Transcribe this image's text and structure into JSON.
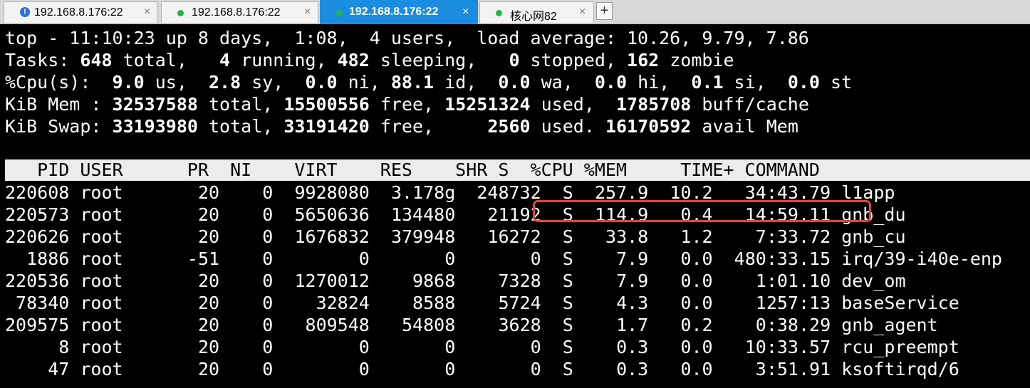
{
  "tabs": [
    {
      "label": "192.168.8.176:22",
      "status": "warning",
      "icon": "info-icon",
      "active": false
    },
    {
      "label": "192.168.8.176:22",
      "status": "connected",
      "icon": "status-dot-icon",
      "active": false
    },
    {
      "label": "192.168.8.176:22",
      "status": "connected",
      "icon": "status-dot-icon",
      "active": true
    },
    {
      "label": "核心网82",
      "status": "connected",
      "icon": "status-dot-icon",
      "active": false
    }
  ],
  "tab_close_glyph": "×",
  "new_tab_glyph": "+",
  "summary": {
    "line1": "top - 11:10:23 up 8 days,  1:08,  4 users,  load average: 10.26, 9.79, 7.86",
    "tasks": {
      "prefix": "Tasks: ",
      "total": "648",
      "total_lbl": " total,   ",
      "running": "4",
      "running_lbl": " running, ",
      "sleeping": "482",
      "sleeping_lbl": " sleeping,   ",
      "stopped": "0",
      "stopped_lbl": " stopped, ",
      "zombie": "162",
      "zombie_lbl": " zombie"
    },
    "cpu": {
      "prefix": "%Cpu(s):  ",
      "us": "9.0",
      "us_lbl": " us,  ",
      "sy": "2.8",
      "sy_lbl": " sy,  ",
      "ni": "0.0",
      "ni_lbl": " ni, ",
      "id": "88.1",
      "id_lbl": " id,  ",
      "wa": "0.0",
      "wa_lbl": " wa,  ",
      "hi": "0.0",
      "hi_lbl": " hi,  ",
      "si": "0.1",
      "si_lbl": " si,  ",
      "st": "0.0",
      "st_lbl": " st"
    },
    "mem": {
      "prefix": "KiB Mem : ",
      "total": "32537588",
      "total_lbl": " total, ",
      "free": "15500556",
      "free_lbl": " free, ",
      "used": "15251324",
      "used_lbl": " used,  ",
      "buff": "1785708",
      "buff_lbl": " buff/cache"
    },
    "swap": {
      "prefix": "KiB Swap: ",
      "total": "33193980",
      "total_lbl": " total, ",
      "free": "33191420",
      "free_lbl": " free,     ",
      "used": "2560",
      "used_lbl": " used. ",
      "avail": "16170592",
      "avail_lbl": " avail Mem"
    }
  },
  "table": {
    "header": "   PID USER      PR  NI    VIRT    RES    SHR S  %CPU %MEM     TIME+ COMMAND",
    "rows": [
      {
        "pid": "220608",
        "user": "root",
        "pr": "20",
        "ni": "0",
        "virt": "9928080",
        "res": "3.178g",
        "shr": "248732",
        "s": "S",
        "cpu": "257.9",
        "mem": "10.2",
        "time": "34:43.79",
        "cmd": "l1app"
      },
      {
        "pid": "220573",
        "user": "root",
        "pr": "20",
        "ni": "0",
        "virt": "5650636",
        "res": "134480",
        "shr": "21192",
        "s": "S",
        "cpu": "114.9",
        "mem": "0.4",
        "time": "14:59.11",
        "cmd": "gnb_du"
      },
      {
        "pid": "220626",
        "user": "root",
        "pr": "20",
        "ni": "0",
        "virt": "1676832",
        "res": "379948",
        "shr": "16272",
        "s": "S",
        "cpu": "33.8",
        "mem": "1.2",
        "time": "7:33.72",
        "cmd": "gnb_cu"
      },
      {
        "pid": "1886",
        "user": "root",
        "pr": "-51",
        "ni": "0",
        "virt": "0",
        "res": "0",
        "shr": "0",
        "s": "S",
        "cpu": "7.9",
        "mem": "0.0",
        "time": "480:33.15",
        "cmd": "irq/39-i40e-enp"
      },
      {
        "pid": "220536",
        "user": "root",
        "pr": "20",
        "ni": "0",
        "virt": "1270012",
        "res": "9868",
        "shr": "7328",
        "s": "S",
        "cpu": "7.9",
        "mem": "0.0",
        "time": "1:01.10",
        "cmd": "dev_om"
      },
      {
        "pid": "78340",
        "user": "root",
        "pr": "20",
        "ni": "0",
        "virt": "32824",
        "res": "8588",
        "shr": "5724",
        "s": "S",
        "cpu": "4.3",
        "mem": "0.0",
        "time": "1257:13",
        "cmd": "baseService"
      },
      {
        "pid": "209575",
        "user": "root",
        "pr": "20",
        "ni": "0",
        "virt": "809548",
        "res": "54808",
        "shr": "3628",
        "s": "S",
        "cpu": "1.7",
        "mem": "0.2",
        "time": "0:38.29",
        "cmd": "gnb_agent"
      },
      {
        "pid": "8",
        "user": "root",
        "pr": "20",
        "ni": "0",
        "virt": "0",
        "res": "0",
        "shr": "0",
        "s": "S",
        "cpu": "0.3",
        "mem": "0.0",
        "time": "10:33.57",
        "cmd": "rcu_preempt"
      },
      {
        "pid": "47",
        "user": "root",
        "pr": "20",
        "ni": "0",
        "virt": "0",
        "res": "0",
        "shr": "0",
        "s": "S",
        "cpu": "0.3",
        "mem": "0.0",
        "time": "3:51.91",
        "cmd": "ksoftirqd/6"
      }
    ]
  },
  "colors": {
    "active_tab": "#1a8de0",
    "annotation": "#e0443c",
    "connected_dot": "#1db845",
    "warning_icon": "#2a6fd8"
  }
}
